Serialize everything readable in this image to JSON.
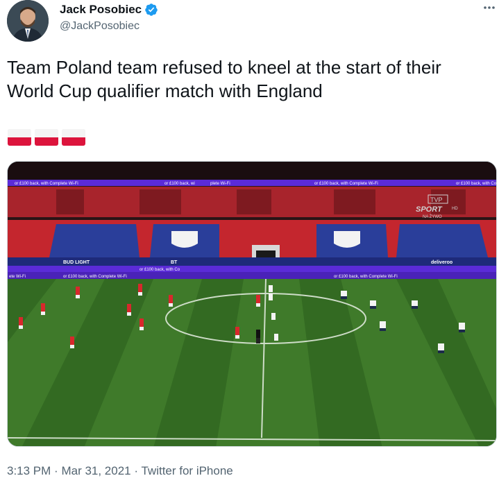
{
  "author": {
    "display_name": "Jack Posobiec",
    "handle": "@JackPosobiec",
    "verified": true,
    "avatar_icon": "profile-photo"
  },
  "tweet": {
    "text": "Team Poland team refused to kneel at the start of their World Cup qualifier match with England",
    "flag_emojis": [
      "polish-flag",
      "polish-flag",
      "polish-flag"
    ]
  },
  "media": {
    "ad_boards": [
      "or £100 back, with Complete Wi-Fi",
      "or £100 back, wi",
      "plete Wi-Fi",
      "or £100 back, with Complete Wi-Fi",
      "or £100 back, with Co"
    ],
    "lower_boards": [
      "ete Wi-Fi",
      "or £100 back, with Complete Wi-Fi",
      "or £100 back, with Co",
      "or £100 back, with Complete Wi-Fi"
    ],
    "broadcaster_logo": "TVP",
    "broadcaster_sub": "SPORT",
    "broadcaster_hd": "HD",
    "broadcaster_live": "NA ŻYWO",
    "sponsor_boards": [
      "BUD LIGHT",
      "BT",
      "deliveroo"
    ]
  },
  "meta": {
    "time": "3:13 PM",
    "separator": "·",
    "date": "Mar 31, 2021",
    "source": "Twitter for iPhone"
  },
  "colors": {
    "verified": "#1d9bf0",
    "text_secondary": "#536471",
    "pitch_light": "#3f7a2a",
    "pitch_dark": "#336a22",
    "stand_red": "#c4262e",
    "ad_purple": "#5b2bd8"
  }
}
